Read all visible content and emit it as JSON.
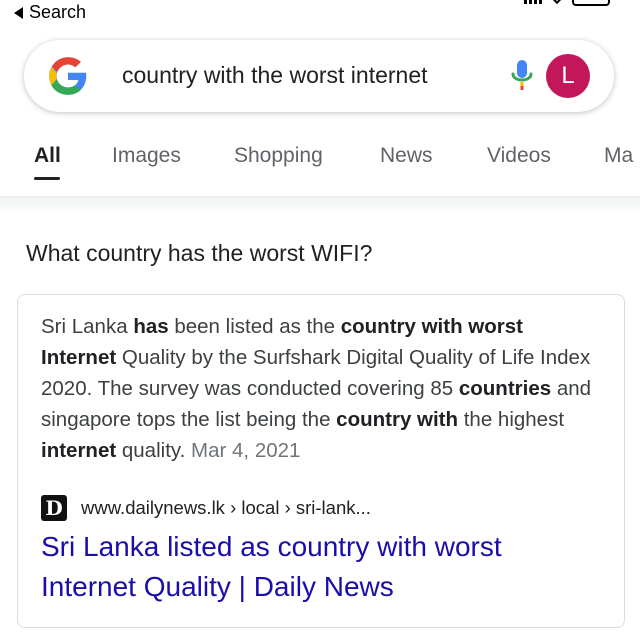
{
  "status_bar": {
    "back_label": "Search"
  },
  "search": {
    "query": "country with the worst internet",
    "avatar_letter": "L"
  },
  "tabs": [
    {
      "label": "All",
      "active": true
    },
    {
      "label": "Images",
      "active": false
    },
    {
      "label": "Shopping",
      "active": false
    },
    {
      "label": "News",
      "active": false
    },
    {
      "label": "Videos",
      "active": false
    },
    {
      "label": "Ma",
      "active": false
    }
  ],
  "question": "What country has the worst WIFI?",
  "answer": {
    "snippet": [
      {
        "text": "Sri Lanka ",
        "bold": false
      },
      {
        "text": "has",
        "bold": true
      },
      {
        "text": " been listed as the ",
        "bold": false
      },
      {
        "text": "country with worst Internet",
        "bold": true
      },
      {
        "text": " Quality by the Surfshark Digital Quality of Life Index 2020. The survey was conducted covering 85 ",
        "bold": false
      },
      {
        "text": "countries",
        "bold": true
      },
      {
        "text": " and singapore tops the list being the ",
        "bold": false
      },
      {
        "text": "country with",
        "bold": true
      },
      {
        "text": " the highest ",
        "bold": false
      },
      {
        "text": "internet",
        "bold": true
      },
      {
        "text": " quality.",
        "bold": false
      }
    ],
    "date": "Mar 4, 2021",
    "favicon_glyph": "D",
    "source_url": "www.dailynews.lk › local › sri-lank...",
    "result_title": "Sri Lanka listed as country with worst Internet Quality | Daily News"
  },
  "colors": {
    "link": "#1a0dab",
    "avatar_bg": "#c2185b",
    "google_blue": "#4285F4",
    "google_red": "#EA4335",
    "google_yellow": "#FBBC05",
    "google_green": "#34A853"
  },
  "icons": [
    "back-arrow-icon",
    "signal-icon",
    "wifi-icon",
    "battery-icon",
    "google-logo-icon",
    "microphone-icon",
    "site-favicon-icon"
  ]
}
